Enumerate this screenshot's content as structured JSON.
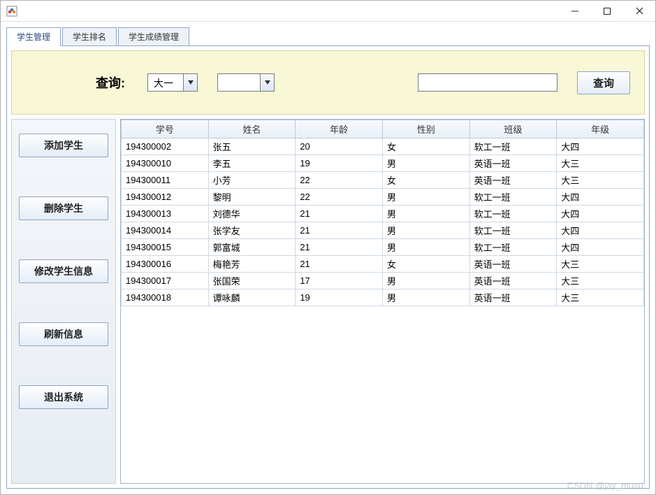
{
  "window": {
    "title": ""
  },
  "tabs": [
    {
      "label": "学生管理",
      "active": true
    },
    {
      "label": "学生排名",
      "active": false
    },
    {
      "label": "学生成绩管理",
      "active": false
    }
  ],
  "query": {
    "label": "查询:",
    "grade_select": "大一",
    "class_select": "",
    "search_value": "",
    "button": "查询"
  },
  "sidebar": {
    "add": "添加学生",
    "delete": "删除学生",
    "modify": "修改学生信息",
    "refresh": "刷新信息",
    "exit": "退出系统"
  },
  "table": {
    "columns": [
      "学号",
      "姓名",
      "年龄",
      "性别",
      "班级",
      "年级"
    ],
    "rows": [
      [
        "194300002",
        "张五",
        "20",
        "女",
        "软工一班",
        "大四"
      ],
      [
        "194300010",
        "李五",
        "19",
        "男",
        "英语一班",
        "大三"
      ],
      [
        "194300011",
        "小芳",
        "22",
        "女",
        "英语一班",
        "大三"
      ],
      [
        "194300012",
        "黎明",
        "22",
        "男",
        "软工一班",
        "大四"
      ],
      [
        "194300013",
        "刘德华",
        "21",
        "男",
        "软工一班",
        "大四"
      ],
      [
        "194300014",
        "张学友",
        "21",
        "男",
        "软工一班",
        "大四"
      ],
      [
        "194300015",
        "郭富城",
        "21",
        "男",
        "软工一班",
        "大四"
      ],
      [
        "194300016",
        "梅艳芳",
        "21",
        "女",
        "英语一班",
        "大三"
      ],
      [
        "194300017",
        "张国荣",
        "17",
        "男",
        "英语一班",
        "大三"
      ],
      [
        "194300018",
        "谭咏麟",
        "19",
        "男",
        "英语一班",
        "大三"
      ]
    ]
  },
  "watermark": "CSDN @jay_musu"
}
